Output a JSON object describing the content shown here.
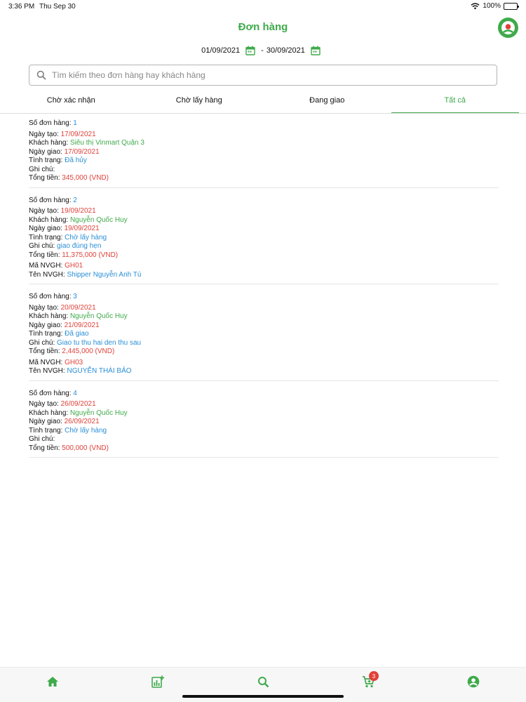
{
  "status_bar": {
    "time": "3:36 PM",
    "date": "Thu Sep 30",
    "battery": "100%"
  },
  "header": {
    "title": "Đơn hàng"
  },
  "date_range": {
    "from": "01/09/2021",
    "separator": "-",
    "to": "30/09/2021"
  },
  "search": {
    "placeholder": "Tìm kiếm theo đơn hàng hay khách hàng"
  },
  "tabs": [
    {
      "label": "Chờ xác nhận"
    },
    {
      "label": "Chờ lấy hàng"
    },
    {
      "label": "Đang giao"
    },
    {
      "label": "Tất cả",
      "active": true
    }
  ],
  "labels": {
    "order_no": "Số đơn hàng:",
    "created": "Ngày tạo:",
    "customer": "Khách hàng:",
    "delivery": "Ngày giao:",
    "status": "Tình trạng:",
    "note": "Ghi chú:",
    "total": "Tổng tiền:",
    "shipper_code": "Mã NVGH:",
    "shipper_name": "Tên NVGH:"
  },
  "orders": [
    {
      "number": "1",
      "created": "17/09/2021",
      "customer": "Siêu thị Vinmart Quận 3",
      "delivery": "17/09/2021",
      "status": "Đã hủy",
      "note": "",
      "total": "345,000 (VND)",
      "shipper_code": "",
      "shipper_name": ""
    },
    {
      "number": "2",
      "created": "19/09/2021",
      "customer": "Nguyễn Quốc Huy",
      "delivery": "19/09/2021",
      "status": "Chờ lấy hàng",
      "note": "giao đúng hẹn",
      "total": "11,375,000 (VND)",
      "shipper_code": "GH01",
      "shipper_name": "Shipper Nguyễn Anh Tú"
    },
    {
      "number": "3",
      "created": "20/09/2021",
      "customer": "Nguyễn Quốc Huy",
      "delivery": "21/09/2021",
      "status": "Đã giao",
      "note": "Giao tu thu hai den thu sau",
      "total": "2,445,000 (VND)",
      "shipper_code": "GH03",
      "shipper_name": "NGUYỄN THÁI BẢO"
    },
    {
      "number": "4",
      "created": "26/09/2021",
      "customer": "Nguyễn Quốc Huy",
      "delivery": "26/09/2021",
      "status": "Chờ lấy hàng",
      "note": "",
      "total": "500,000 (VND)",
      "shipper_code": "",
      "shipper_name": ""
    }
  ],
  "bottom_nav": {
    "items": [
      {
        "icon": "home-icon"
      },
      {
        "icon": "add-chart-icon"
      },
      {
        "icon": "search-icon"
      },
      {
        "icon": "cart-icon",
        "badge": "3"
      },
      {
        "icon": "account-icon"
      }
    ]
  },
  "colors": {
    "accent": "#3faa4b",
    "red": "#e0413a",
    "blue": "#2a8fd6"
  }
}
